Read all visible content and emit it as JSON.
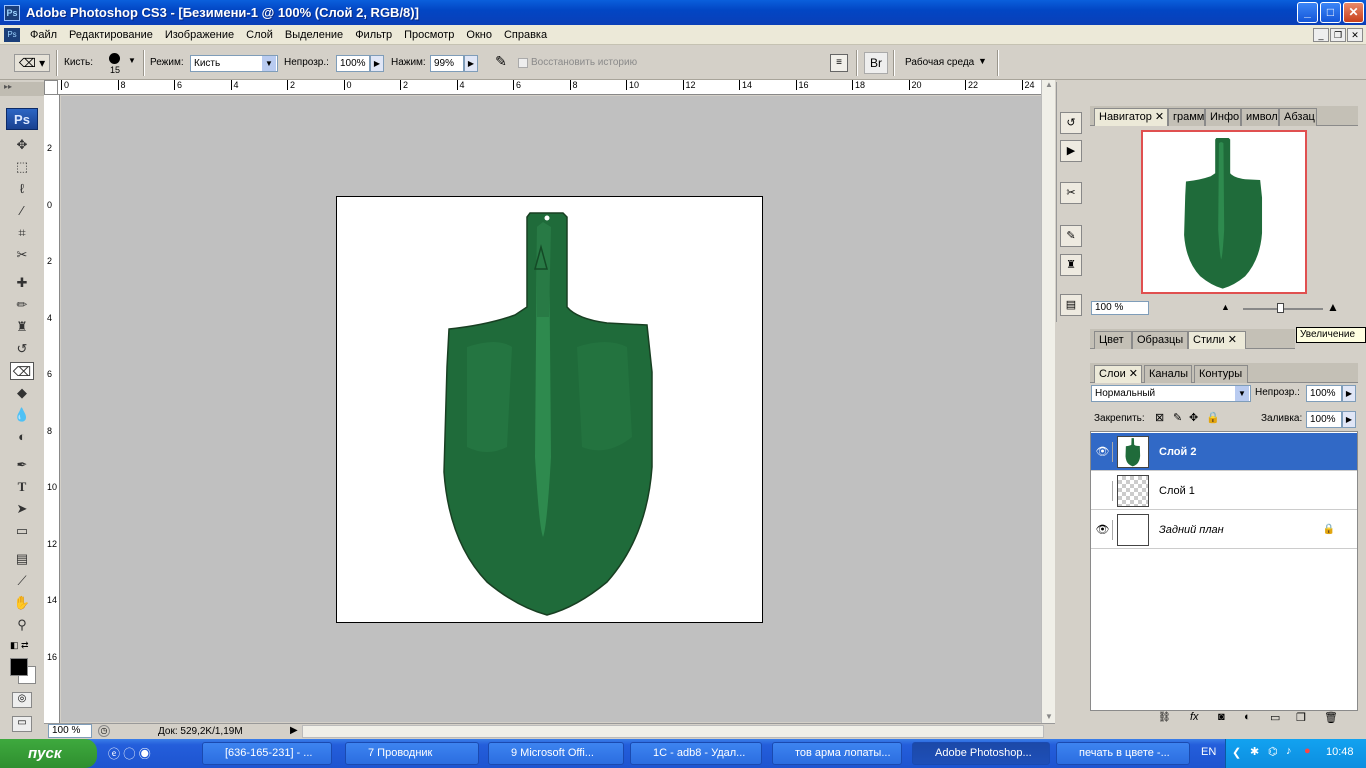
{
  "window": {
    "title": "Adobe Photoshop CS3 - [Безимени-1 @ 100% (Слой 2, RGB/8)]"
  },
  "menu": [
    "Файл",
    "Редактирование",
    "Изображение",
    "Слой",
    "Выделение",
    "Фильтр",
    "Просмотр",
    "Окно",
    "Справка"
  ],
  "options": {
    "brush_label": "Кисть:",
    "brush_size": "15",
    "mode_label": "Режим:",
    "mode_value": "Кисть",
    "opacity_label": "Непрозр.:",
    "opacity_value": "100%",
    "flow_label": "Нажим:",
    "flow_value": "99%",
    "erase_history": "Восстановить историю",
    "workspace": "Рабочая среда"
  },
  "rulers": {
    "top": [
      "0",
      "8",
      "6",
      "4",
      "2",
      "0",
      "2",
      "4",
      "6",
      "8",
      "10",
      "12",
      "14",
      "16",
      "18",
      "20",
      "22",
      "24"
    ],
    "left": [
      "2",
      "0",
      "2",
      "4",
      "6",
      "8",
      "10",
      "12",
      "14",
      "16"
    ]
  },
  "status": {
    "zoom": "100 %",
    "doc": "Док: 529,2K/1,19M"
  },
  "navigator": {
    "tabs": [
      "Навигатор",
      "грамма",
      "Инфо",
      "имвол",
      "Абзац"
    ],
    "zoom": "100 %",
    "tooltip": "Увеличение"
  },
  "styles_panel": {
    "tabs": [
      "Цвет",
      "Образцы",
      "Стили"
    ]
  },
  "layers_panel": {
    "tabs": [
      "Слои",
      "Каналы",
      "Контуры"
    ],
    "blend_mode": "Нормальный",
    "opacity_label": "Непрозр.:",
    "opacity_value": "100%",
    "lock_label": "Закрепить:",
    "fill_label": "Заливка:",
    "fill_value": "100%",
    "layers": [
      {
        "name": "Слой 2",
        "visible": true,
        "selected": true
      },
      {
        "name": "Слой 1",
        "visible": false,
        "selected": false
      },
      {
        "name": "Задний план",
        "visible": true,
        "selected": false,
        "locked": true
      }
    ]
  },
  "taskbar": {
    "start": "пуск",
    "tasks": [
      "[636-165-231] - ...",
      "7 Проводник",
      "9 Microsoft Offi...",
      "1С - adb8 - Удал...",
      "тов арма лопаты...",
      "Adobe Photoshop...",
      "печать в цвете -..."
    ],
    "lang": "EN",
    "clock": "10:48"
  },
  "colors": {
    "shovel": "#1f6b3a",
    "selection": "#3169c6",
    "nav_frame": "#e05050"
  }
}
